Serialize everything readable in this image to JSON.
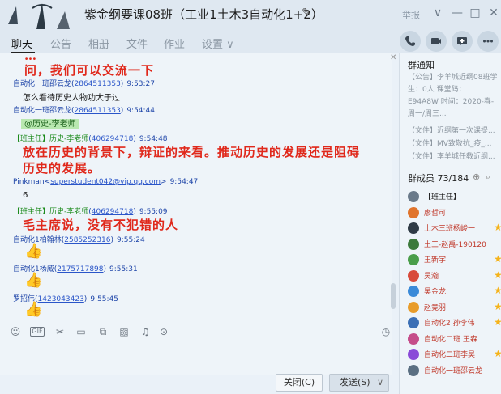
{
  "window": {
    "title": "紫金纲要课08班（工业1土木3自动化1+2）",
    "report": "举报",
    "controls": [
      "∨",
      "—",
      "□",
      "✕"
    ]
  },
  "tabs": [
    "聊天",
    "公告",
    "相册",
    "文件",
    "作业",
    "设置 ∨"
  ],
  "messages": [
    {
      "type": "big",
      "text": "问，我们可以交流一下"
    },
    {
      "type": "header",
      "who": "自动化一班邵云龙",
      "id": "2864511353",
      "time": "9:53:27"
    },
    {
      "type": "text",
      "text": "怎么看待历史人物功大于过"
    },
    {
      "type": "header",
      "who": "自动化一班邵云龙",
      "id": "2864511353",
      "time": "9:54:44"
    },
    {
      "type": "at",
      "text": "@历史-李老师"
    },
    {
      "type": "header",
      "who": "【班主任】历史-李老师",
      "id": "406294718",
      "time": "9:54:48"
    },
    {
      "type": "big",
      "text": "放在历史的背景下，辩证的来看。推动历史的发展还是阻碍"
    },
    {
      "type": "big",
      "text": "历史的发展。"
    },
    {
      "type": "email",
      "who": "Pinkman",
      "id": "superstudent042@vip.qq.com",
      "time": "9:54:47"
    },
    {
      "type": "text",
      "text": "6"
    },
    {
      "type": "header",
      "who": "【班主任】历史-李老师",
      "id": "406294718",
      "time": "9:55:09"
    },
    {
      "type": "big",
      "text": "毛主席说，没有不犯错的人"
    },
    {
      "type": "header",
      "who": "自动化1柏翰林",
      "id": "2585252316",
      "time": "9:55:24"
    },
    {
      "type": "header",
      "who": "自动化1杨威",
      "id": "2175717898",
      "time": "9:55:31"
    },
    {
      "type": "header",
      "who": "罗招伟",
      "id": "1423043423",
      "time": "9:55:45"
    }
  ],
  "buttons": {
    "close": "关闭(C)",
    "send": "发送(S)",
    "send_arrow": "∨"
  },
  "notice": {
    "title": "群通知",
    "lines": [
      "【公告】李羊城近纲08班学",
      "生：0人 课堂码：",
      "E94A8W 时间：2020-春-",
      "周一/周三...",
      "【文件】近纲第一次课提...",
      "【文件】MV致敬抗_疫_...",
      "【文件】李羊城任教近纲..."
    ]
  },
  "members": {
    "title": "群成员 73/184",
    "list": [
      {
        "name": "【班主任】",
        "color": "#222",
        "star": false
      },
      {
        "name": "廖哲可",
        "color": "#c0392b",
        "star": false
      },
      {
        "name": "土木三班杨峻一",
        "color": "#c0392b",
        "star": true
      },
      {
        "name": "土三-赵禹-190120",
        "color": "#c0392b",
        "star": false
      },
      {
        "name": "王新宇",
        "color": "#c0392b",
        "star": true
      },
      {
        "name": "吴瀚",
        "color": "#c0392b",
        "star": true
      },
      {
        "name": "吴金龙",
        "color": "#c0392b",
        "star": true
      },
      {
        "name": "赵竟羽",
        "color": "#c0392b",
        "star": true
      },
      {
        "name": "自动化2 孙李伟",
        "color": "#c0392b",
        "star": true
      },
      {
        "name": "自动化二班 王森",
        "color": "#c0392b",
        "star": false
      },
      {
        "name": "自动化二班李昊",
        "color": "#c0392b",
        "star": true
      },
      {
        "name": "自动化一班邵云龙",
        "color": "#c0392b",
        "star": false
      }
    ]
  }
}
